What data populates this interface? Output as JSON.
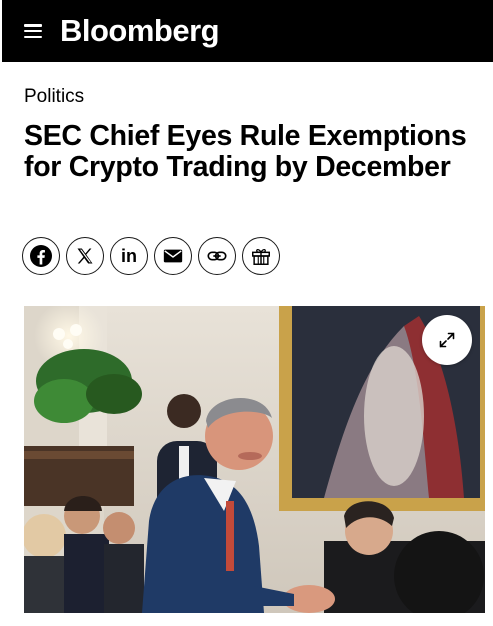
{
  "header": {
    "brand": "Bloomberg",
    "menu_icon": "hamburger-menu-icon"
  },
  "article": {
    "section": "Politics",
    "headline": "SEC Chief Eyes Rule Exemptions for Crypto Trading by December"
  },
  "share": {
    "buttons": [
      {
        "icon": "facebook-icon"
      },
      {
        "icon": "x-icon"
      },
      {
        "icon": "linkedin-icon",
        "text": "in"
      },
      {
        "icon": "email-icon"
      },
      {
        "icon": "link-icon"
      },
      {
        "icon": "gift-icon"
      }
    ]
  },
  "media": {
    "photo": "article-photo",
    "expand_icon": "expand-icon"
  },
  "colors": {
    "topbar": "#000000",
    "text": "#000000",
    "background": "#ffffff"
  }
}
